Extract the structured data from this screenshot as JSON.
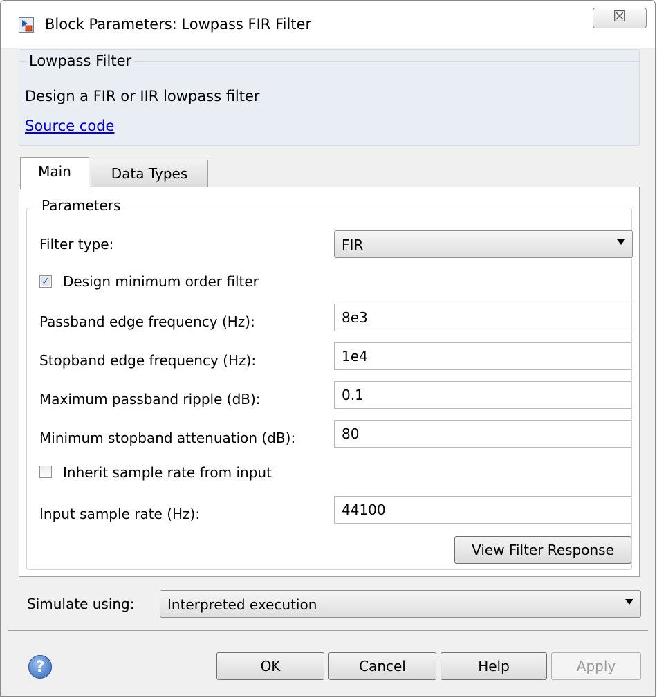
{
  "window": {
    "title": "Block Parameters: Lowpass FIR Filter",
    "close_glyph": "☒"
  },
  "description": {
    "legend": "Lowpass Filter",
    "text": "Design a FIR or IIR lowpass filter",
    "source_link": "Source code"
  },
  "tabs": [
    {
      "label": "Main",
      "selected": true
    },
    {
      "label": "Data Types",
      "selected": false
    }
  ],
  "parameters": {
    "legend": "Parameters",
    "filter_type_label": "Filter type:",
    "filter_type_value": "FIR",
    "min_order_label": "Design minimum order filter",
    "min_order_checked": true,
    "passband_label": "Passband edge frequency (Hz):",
    "passband_value": "8e3",
    "stopband_label": "Stopband edge frequency (Hz):",
    "stopband_value": "1e4",
    "ripple_label": "Maximum passband ripple (dB):",
    "ripple_value": "0.1",
    "attenuation_label": "Minimum stopband attenuation (dB):",
    "attenuation_value": "80",
    "inherit_label": "Inherit sample rate from input",
    "inherit_checked": false,
    "sample_rate_label": "Input sample rate (Hz):",
    "sample_rate_value": "44100",
    "view_response_button": "View Filter Response"
  },
  "simulate": {
    "label": "Simulate using:",
    "value": "Interpreted execution"
  },
  "footer": {
    "ok": "OK",
    "cancel": "Cancel",
    "help": "Help",
    "apply": "Apply",
    "help_icon": "?"
  }
}
